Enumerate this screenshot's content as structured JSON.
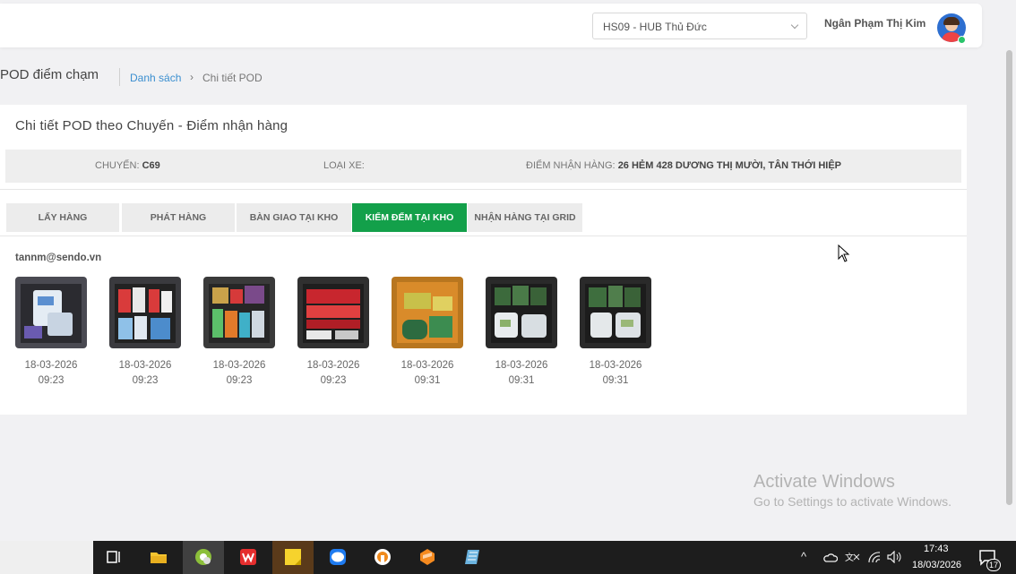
{
  "header": {
    "hub_select_value": "HS09 - HUB Thủ Đức",
    "user_name": "Ngân Phạm Thị Kim"
  },
  "breadcrumb": {
    "page_title": "POD điểm chạm",
    "link": "Danh sách",
    "separator": "›",
    "current": "Chi tiết POD"
  },
  "card": {
    "title": "Chi tiết POD theo Chuyến - Điểm nhận hàng",
    "info": {
      "trip_label": "CHUYẾN:",
      "trip_value": "C69",
      "vehicle_label": "LOẠI XE:",
      "vehicle_value": "",
      "pickup_label": "ĐIỂM NHẬN HÀNG:",
      "pickup_value": "26 HẺM 428 DƯƠNG THỊ MƯỜI, TÂN THỚI HIỆP"
    },
    "tabs": [
      {
        "label": "LẤY HÀNG",
        "active": false
      },
      {
        "label": "PHÁT HÀNG",
        "active": false
      },
      {
        "label": "BÀN GIAO TẠI KHO",
        "active": false
      },
      {
        "label": "KIỂM ĐẾM TẠI KHO",
        "active": true
      },
      {
        "label": "NHẬN HÀNG TẠI GRID",
        "active": false
      }
    ],
    "email": "tannm@sendo.vn",
    "photos": [
      {
        "date": "18-03-2026",
        "time": "09:23"
      },
      {
        "date": "18-03-2026",
        "time": "09:23"
      },
      {
        "date": "18-03-2026",
        "time": "09:23"
      },
      {
        "date": "18-03-2026",
        "time": "09:23"
      },
      {
        "date": "18-03-2026",
        "time": "09:31"
      },
      {
        "date": "18-03-2026",
        "time": "09:31"
      },
      {
        "date": "18-03-2026",
        "time": "09:31"
      }
    ]
  },
  "watermark": {
    "title": "Activate Windows",
    "subtitle": "Go to Settings to activate Windows."
  },
  "taskbar": {
    "time": "17:43",
    "date": "18/03/2026",
    "notification_count": "17",
    "apps": [
      "task-view-icon",
      "file-explorer-icon",
      "coccoc-browser-icon",
      "wps-office-icon",
      "sticky-notes-icon",
      "zalo-icon",
      "ultraviewer-icon",
      "sublime-icon",
      "notepad-icon"
    ]
  },
  "colors": {
    "active_tab": "#13a04a",
    "link": "#3b8fd0",
    "taskbar": "#1d1d1d"
  }
}
